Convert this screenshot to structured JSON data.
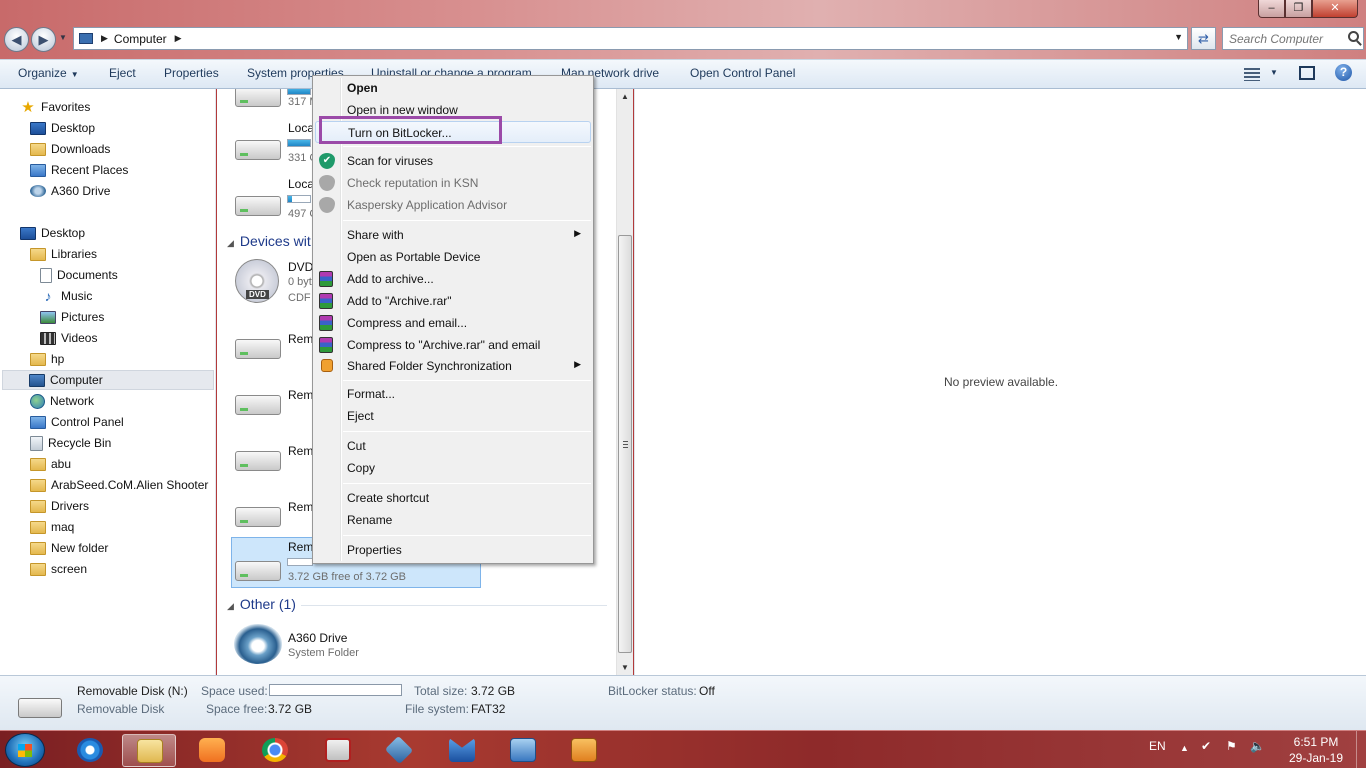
{
  "window": {
    "address_path": "Computer",
    "search_placeholder": "Search Computer"
  },
  "command_bar": {
    "organize": "Organize",
    "eject": "Eject",
    "properties": "Properties",
    "system_properties": "System properties",
    "uninstall": "Uninstall or change a program",
    "map_network_drive": "Map network drive",
    "open_control_panel": "Open Control Panel"
  },
  "nav": {
    "favorites": [
      "Favorites",
      "Desktop",
      "Downloads",
      "Recent Places",
      "A360 Drive"
    ],
    "tree": [
      "Desktop",
      "Libraries",
      "Documents",
      "Music",
      "Pictures",
      "Videos",
      "hp",
      "Computer",
      "Network",
      "Control Panel",
      "Recycle Bin",
      "abu",
      "ArabSeed.CoM.Alien Shooter",
      "Drivers",
      "maq",
      "New folder",
      "screen"
    ]
  },
  "content": {
    "drive1_sub": "317 M",
    "drive2_name": "Loca",
    "drive2_sub": "331 G",
    "drive3_name": "Loca",
    "drive3_sub": "497 G",
    "group_devices": "Devices wit",
    "dvd_name": "DVD",
    "dvd_sub1": "0 byt",
    "dvd_sub2": "CDF",
    "dvd_label": "DVD",
    "removable_short": "Rem",
    "selected_free": "3.72 GB free of 3.72 GB",
    "group_other": "Other (1)",
    "a360_name": "A360 Drive",
    "a360_sub": "System Folder"
  },
  "preview": {
    "text": "No preview available."
  },
  "context_menu": {
    "items": [
      "Open",
      "Open in new window",
      "Turn on BitLocker...",
      "Scan for viruses",
      "Check reputation in KSN",
      "Kaspersky Application Advisor",
      "Share with",
      "Open as Portable Device",
      "Add to archive...",
      "Add to \"Archive.rar\"",
      "Compress and email...",
      "Compress to \"Archive.rar\" and email",
      "Shared Folder Synchronization",
      "Format...",
      "Eject",
      "Cut",
      "Copy",
      "Create shortcut",
      "Rename",
      "Properties"
    ]
  },
  "details": {
    "name": "Removable Disk (N:)",
    "type": "Removable Disk",
    "space_used_label": "Space used:",
    "space_free_label": "Space free:",
    "space_free": "3.72 GB",
    "total_size_label": "Total size:",
    "total_size": "3.72 GB",
    "file_system_label": "File system:",
    "file_system": "FAT32",
    "bitlocker_label": "BitLocker status:",
    "bitlocker_status": "Off"
  },
  "taskbar": {
    "language": "EN",
    "time": "6:51 PM",
    "date": "29-Jan-19"
  },
  "colors": {
    "highlight_box": "#9b4aa8",
    "selection": "#cde6fb",
    "group_header": "#1e3a8a"
  }
}
